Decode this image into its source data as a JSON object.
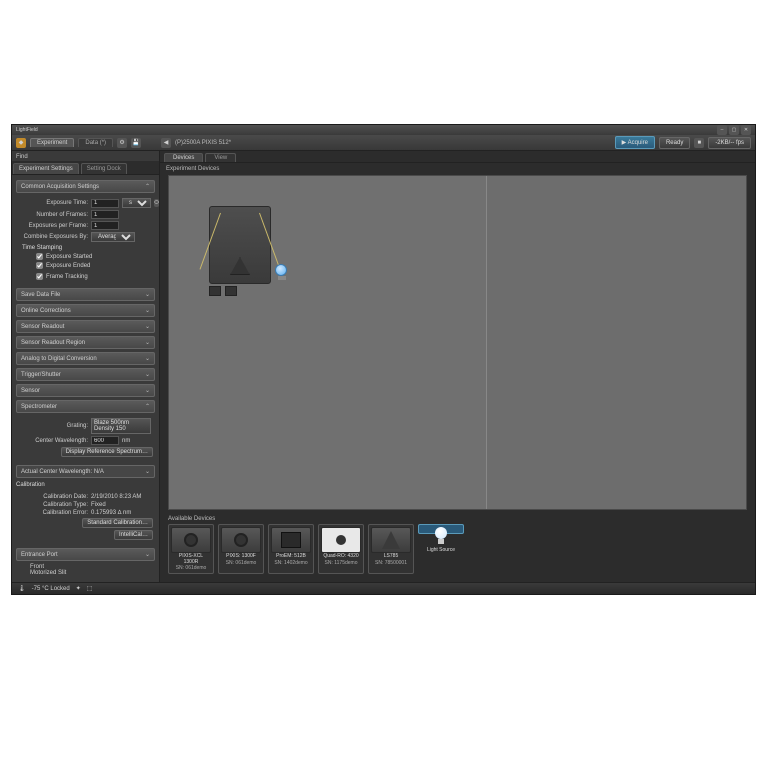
{
  "window": {
    "title": "LightField"
  },
  "toolbar": {
    "tabs": [
      "Experiment",
      "Data (*)"
    ],
    "doc_title": "(P)2500A PIXIS 512*",
    "acquire": "Acquire",
    "status": "Ready",
    "frame_info": "-2KB/-- fps"
  },
  "sidepanel": {
    "header": "Find",
    "tabs": [
      "Experiment Settings",
      "Setting Dock"
    ],
    "common": {
      "title": "Common Acquisition Settings",
      "exposure_time_label": "Exposure Time:",
      "exposure_time_value": "1",
      "exposure_time_unit": "s",
      "num_frames_label": "Number of Frames:",
      "num_frames_value": "1",
      "exp_per_frame_label": "Exposures per Frame:",
      "exp_per_frame_value": "1",
      "combine_label": "Combine Exposures By:",
      "combine_value": "Average",
      "time_stamping": "Time Stamping",
      "exp_started": "Exposure Started",
      "exp_ended": "Exposure Ended",
      "frame_tracking": "Frame Tracking"
    },
    "collapsed": [
      "Save Data File",
      "Online Corrections",
      "Sensor Readout",
      "Sensor Readout Region",
      "Analog to Digital Conversion",
      "Trigger/Shutter",
      "Sensor"
    ],
    "spectrometer": {
      "title": "Spectrometer",
      "grating_label": "Grating:",
      "grating_line1": "Blaze 500nm",
      "grating_line2": "Density 150",
      "center_wavelength_label": "Center Wavelength:",
      "center_wavelength_value": "600",
      "center_wavelength_unit": "nm",
      "display_ref_btn": "Display Reference Spectrum…",
      "actual_center": "Actual Center Wavelength: N/A"
    },
    "calibration": {
      "title": "Calibration",
      "date_label": "Calibration Date:",
      "date_value": "2/19/2010 8:23 AM",
      "type_label": "Calibration Type:",
      "type_value": "Fixed",
      "error_label": "Calibration Error:",
      "error_value": "0.175993 ∆ nm",
      "standard_btn": "Standard Calibration…",
      "intellical_btn": "IntelliCal…"
    },
    "entrance": {
      "title": "Entrance Port",
      "front": "Front",
      "motorized": "Motorized Slit"
    }
  },
  "content": {
    "tabs": [
      "Devices",
      "View"
    ],
    "title": "Experiment Devices",
    "available": "Available Devices",
    "devices": [
      {
        "name": "PIXIS-XCL 1300R",
        "sn": "SN: 061demo"
      },
      {
        "name": "PIXIS: 1300F",
        "sn": "SN: 061demo"
      },
      {
        "name": "ProEM: 512B",
        "sn": "SN: 1402demo"
      },
      {
        "name": "Quad-RO: 4320",
        "sn": "SN: 1175demo"
      },
      {
        "name": "LS785",
        "sn": "SN: 78500001"
      },
      {
        "name": "Light Source",
        "sn": ""
      }
    ]
  },
  "statusbar": {
    "temp": "-75 °C Locked"
  }
}
